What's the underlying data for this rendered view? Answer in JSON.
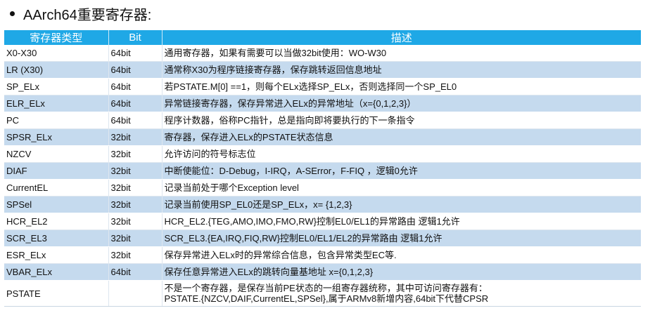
{
  "title": "AArch64重要寄存器:",
  "headers": {
    "name": "寄存器类型",
    "bit": "Bit",
    "desc": "描述"
  },
  "rows": [
    {
      "name": "X0-X30",
      "bit": "64bit",
      "desc": "通用寄存器，如果有需要可以当做32bit使用：WO-W30"
    },
    {
      "name": "LR (X30)",
      "bit": "64bit",
      "desc": "通常称X30为程序链接寄存器，保存跳转返回信息地址"
    },
    {
      "name": "SP_ELx",
      "bit": "64bit",
      "desc": "若PSTATE.M[0] ==1，则每个ELx选择SP_ELx，否则选择同一个SP_EL0"
    },
    {
      "name": "ELR_ELx",
      "bit": "64bit",
      "desc": "异常链接寄存器，保存异常进入ELx的异常地址（x={0,1,2,3}）"
    },
    {
      "name": "PC",
      "bit": "64bit",
      "desc": "程序计数器，俗称PC指针，总是指向即将要执行的下一条指令"
    },
    {
      "name": "SPSR_ELx",
      "bit": "32bit",
      "desc": "寄存器，保存进入ELx的PSTATE状态信息"
    },
    {
      "name": "NZCV",
      "bit": "32bit",
      "desc": "允许访问的符号标志位"
    },
    {
      "name": "DIAF",
      "bit": "32bit",
      "desc": "中断使能位：D-Debug，I-IRQ，A-SError，F-FIQ ，逻辑0允许"
    },
    {
      "name": "CurrentEL",
      "bit": "32bit",
      "desc": "记录当前处于哪个Exception level"
    },
    {
      "name": "SPSel",
      "bit": "32bit",
      "desc": "记录当前使用SP_EL0还是SP_ELx，x= {1,2,3}"
    },
    {
      "name": "HCR_EL2",
      "bit": "32bit",
      "desc": "HCR_EL2.{TEG,AMO,IMO,FMO,RW}控制EL0/EL1的异常路由 逻辑1允许"
    },
    {
      "name": "SCR_EL3",
      "bit": "32bit",
      "desc": "SCR_EL3.{EA,IRQ,FIQ,RW}控制EL0/EL1/EL2的异常路由  逻辑1允许"
    },
    {
      "name": "ESR_ELx",
      "bit": "32bit",
      "desc": "保存异常进入ELx时的异常综合信息，包含异常类型EC等."
    },
    {
      "name": "VBAR_ELx",
      "bit": "64bit",
      "desc": "保存任意异常进入ELx的跳转向量基地址 x={0,1,2,3}"
    }
  ],
  "last_row": {
    "name": "PSTATE",
    "bit": "",
    "desc_line1": "不是一个寄存器，是保存当前PE状态的一组寄存器统称，其中可访问寄存器有：",
    "desc_line2": "PSTATE.{NZCV,DAIF,CurrentEL,SPSel},属于ARMv8新增内容,64bit下代替CPSR"
  }
}
